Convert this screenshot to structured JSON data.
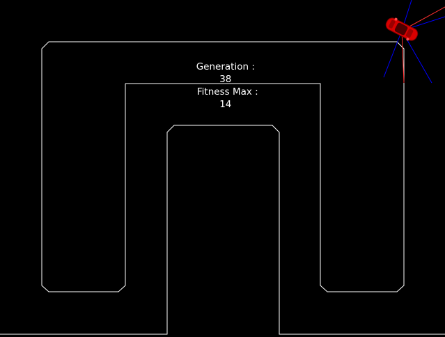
{
  "hud": {
    "generation_label": "Generation :",
    "generation_value": "38",
    "fitness_label": "Fitness Max :",
    "fitness_value": "14"
  },
  "colors": {
    "background": "#000000",
    "track": "#ffffff",
    "hud_text": "#ffffff",
    "car_body": "#e00000",
    "car_window": "#5a0000",
    "sensor_ray": "#0000ff",
    "heading_ray": "#ff0000"
  },
  "icons": {
    "car": "car-icon"
  }
}
